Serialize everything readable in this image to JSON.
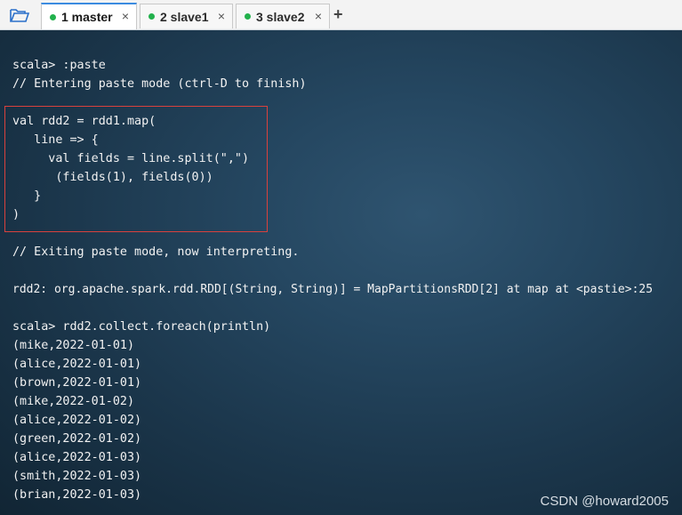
{
  "tabs": [
    {
      "label": "1 master",
      "active": true,
      "status_color": "#22b14c"
    },
    {
      "label": "2 slave1",
      "active": false,
      "status_color": "#22b14c"
    },
    {
      "label": "3 slave2",
      "active": false,
      "status_color": "#22b14c"
    }
  ],
  "tab_close_glyph": "×",
  "new_tab_glyph": "+",
  "terminal": {
    "lines": [
      "scala> :paste",
      "// Entering paste mode (ctrl-D to finish)",
      "val rdd2 = rdd1.map(",
      "   line => {",
      "     val fields = line.split(\",\")",
      "      (fields(1), fields(0))",
      "   }",
      ")",
      "// Exiting paste mode, now interpreting.",
      "rdd2: org.apache.spark.rdd.RDD[(String, String)] = MapPartitionsRDD[2] at map at <pastie>:25",
      "scala> rdd2.collect.foreach(println)",
      "(mike,2022-01-01)",
      "(alice,2022-01-01)",
      "(brown,2022-01-01)",
      "(mike,2022-01-02)",
      "(alice,2022-01-02)",
      "(green,2022-01-02)",
      "(alice,2022-01-03)",
      "(smith,2022-01-03)",
      "(brian,2022-01-03)"
    ]
  },
  "watermark": "CSDN @howard2005",
  "colors": {
    "active_tab_accent": "#3c8be0",
    "highlight_border": "#d9413d",
    "terminal_text": "#f2f2f2"
  },
  "icons": {
    "folder": "folder-open-icon",
    "close": "close-icon",
    "add": "plus-icon"
  }
}
